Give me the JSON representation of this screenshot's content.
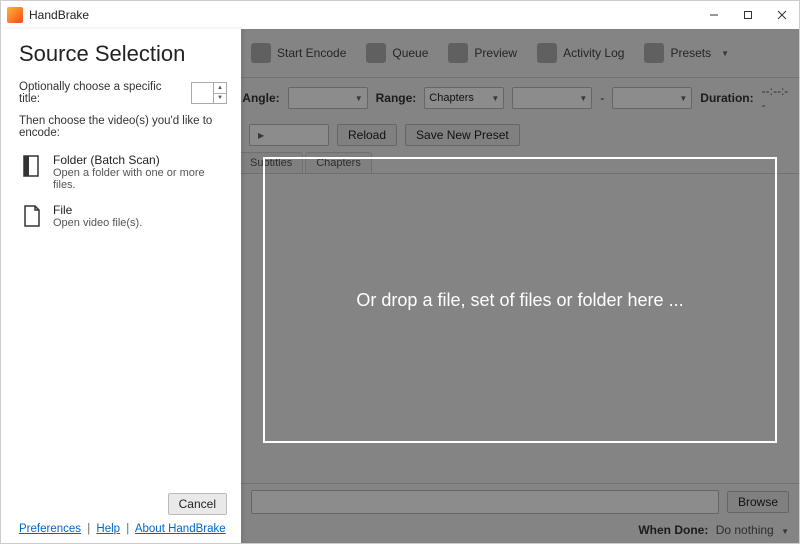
{
  "window": {
    "title": "HandBrake"
  },
  "toolbar": {
    "start_encode": "Start Encode",
    "queue": "Queue",
    "preview": "Preview",
    "activity_log": "Activity Log",
    "presets": "Presets"
  },
  "main": {
    "angle_label": "Angle:",
    "range_label": "Range:",
    "range_mode": "Chapters",
    "range_sep": "-",
    "duration_label": "Duration:",
    "duration_value": "--:--:--",
    "reload": "Reload",
    "save_new_preset": "Save New Preset",
    "tabs": {
      "subtitles": "Subtitles",
      "chapters": "Chapters"
    },
    "browse": "Browse",
    "when_done_label": "When Done:",
    "when_done_value": "Do nothing"
  },
  "source_panel": {
    "heading": "Source Selection",
    "optional_title_label": "Optionally choose a specific title:",
    "instruction": "Then choose the video(s) you'd like to encode:",
    "folder": {
      "title": "Folder (Batch Scan)",
      "sub": "Open a folder with one or more files."
    },
    "file": {
      "title": "File",
      "sub": "Open video file(s)."
    },
    "cancel": "Cancel",
    "links": {
      "preferences": "Preferences",
      "help": "Help",
      "about": "About HandBrake"
    }
  },
  "dropzone": {
    "text": "Or drop a file, set of files or folder here ..."
  }
}
